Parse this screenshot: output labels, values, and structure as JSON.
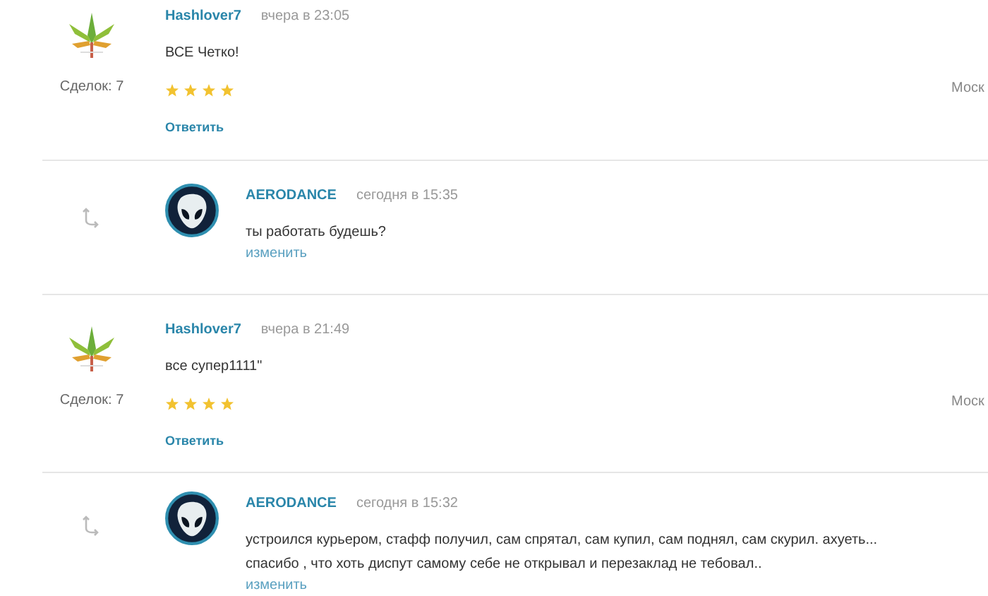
{
  "comments": [
    {
      "kind": "review",
      "author": "Hashlover7",
      "time": "вчера в 23:05",
      "text": "ВСЕ Четко!",
      "deals": "Сделок: 7",
      "stars": 4,
      "city": "Моск",
      "action": "Ответить"
    },
    {
      "kind": "reply",
      "author": "AERODANCE",
      "time": "сегодня в 15:35",
      "text": "ты работать будешь?",
      "action": "изменить"
    },
    {
      "kind": "review",
      "author": "Hashlover7",
      "time": "вчера в 21:49",
      "text": "все супер1111\"",
      "deals": "Сделок: 7",
      "stars": 4,
      "city": "Моск",
      "action": "Ответить"
    },
    {
      "kind": "reply",
      "author": "AERODANCE",
      "time": "сегодня в 15:32",
      "text": "устроился курьером, стафф получил, сам спрятал, сам купил, сам поднял, сам скурил. ахуеть...\nспасибо , что хоть диспут самому себе не открывал и перезаклад не тебовал..",
      "action": "изменить"
    }
  ]
}
